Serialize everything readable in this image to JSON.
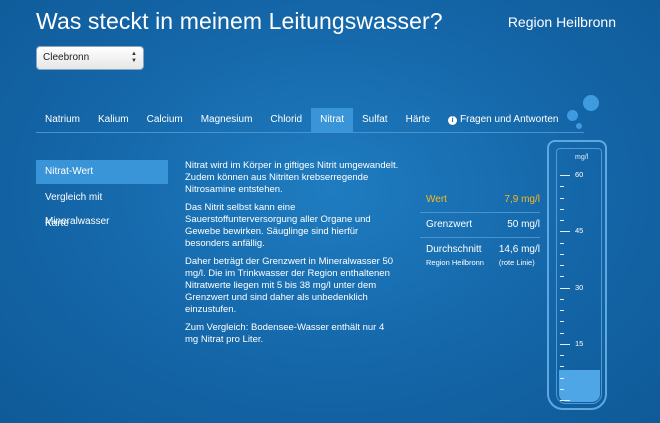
{
  "header": {
    "title": "Was steckt in meinem Leitungswasser?",
    "region": "Region Heilbronn"
  },
  "location_select": {
    "value": "Cleebronn"
  },
  "tabs": [
    {
      "label": "Natrium"
    },
    {
      "label": "Kalium"
    },
    {
      "label": "Calcium"
    },
    {
      "label": "Magnesium"
    },
    {
      "label": "Chlorid"
    },
    {
      "label": "Nitrat",
      "active": true
    },
    {
      "label": "Sulfat"
    },
    {
      "label": "Härte"
    },
    {
      "label": "Fragen und Antworten",
      "icon": "info-icon"
    }
  ],
  "sidebar": {
    "items": [
      {
        "label": "Nitrat-Wert",
        "active": true
      },
      {
        "label": "Vergleich mit Mineralwasser"
      },
      {
        "label": "Karte"
      }
    ]
  },
  "content": {
    "paragraphs": [
      "Nitrat wird im Körper in giftiges Nitrit umgewandelt. Zudem können aus Nitriten krebserregende Nitrosamine entstehen.",
      "Das Nitrit selbst kann eine Sauerstoffunterversorgung aller Organe und Gewebe bewirken. Säuglinge sind hierfür besonders anfällig.",
      "Daher beträgt der Grenzwert in Mineralwasser 50 mg/l. Die im Trinkwasser der Region enthaltenen Nitratwerte liegen mit 5 bis 38 mg/l unter dem Grenzwert und sind daher als unbedenklich einzustufen.",
      "Zum Vergleich: Bodensee-Wasser enthält nur 4 mg Nitrat pro Liter."
    ]
  },
  "values": {
    "wert_label": "Wert",
    "wert_value": "7,9 mg/l",
    "grenzwert_label": "Grenzwert",
    "grenzwert_value": "50 mg/l",
    "durchschnitt_label": "Durchschnitt",
    "durchschnitt_value": "14,6 mg/l",
    "durchschnitt_sub_label": "Region Heilbronn",
    "durchschnitt_sub_value": "(rote Linie)"
  },
  "gauge": {
    "unit": "mg/l",
    "max": 60,
    "labels": [
      "60",
      "45",
      "30",
      "15"
    ],
    "label_values": [
      60,
      45,
      30,
      15
    ],
    "level": 7.9
  },
  "colors": {
    "background": "#1466a8",
    "active_tab": "#3a95d8",
    "highlight_value": "#f5b81f"
  }
}
